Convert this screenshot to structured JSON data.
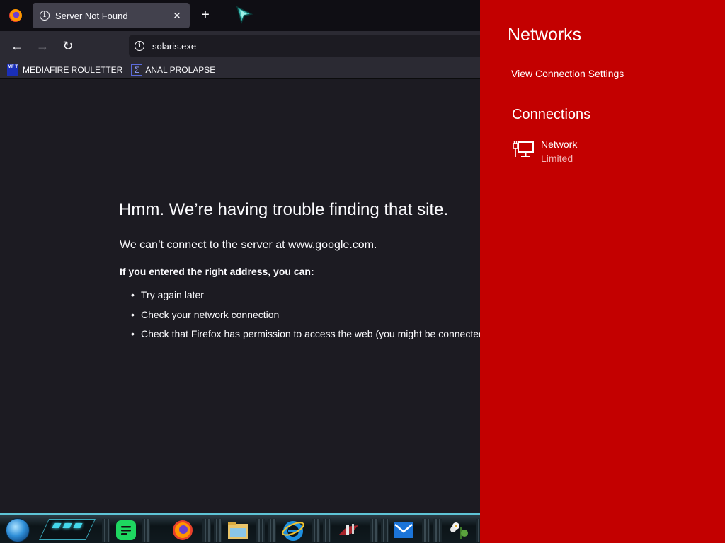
{
  "browser": {
    "tab": {
      "title": "Server Not Found"
    },
    "url": "solaris.exe",
    "bookmarks": [
      {
        "label": "MEDIAFIRE ROULETTER",
        "icon_text": "MF T"
      },
      {
        "label": "ANAL PROLAPSE"
      }
    ],
    "error": {
      "title": "Hmm. We’re having trouble finding that site.",
      "description": "We can’t connect to the server at www.google.com.",
      "subheading": "If you entered the right address, you can:",
      "suggestions": [
        "Try again later",
        "Check your network connection",
        "Check that Firefox has permission to access the web (you might be connected but behind a firewall)"
      ]
    }
  },
  "taskbar": {
    "apps": [
      "spotify-icon",
      "firefox-icon",
      "file-explorer-icon",
      "internet-explorer-icon",
      "game-app-icon",
      "mail-icon",
      "flower-app-icon"
    ],
    "accent_color": "#5ec4d6"
  },
  "flyout": {
    "title": "Networks",
    "settings_link": "View Connection Settings",
    "section": "Connections",
    "network": {
      "name": "Network",
      "status": "Limited"
    },
    "background_color": "#c30000"
  }
}
